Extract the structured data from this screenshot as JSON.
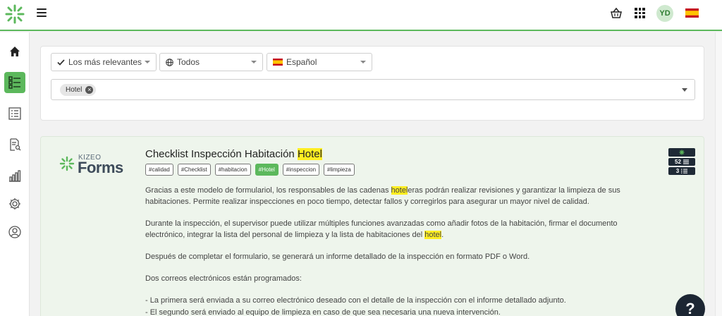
{
  "header": {
    "avatar_initials": "YD",
    "accent_color": "#5cb85c",
    "icons": [
      "kizeo-logo-icon",
      "hamburger-menu-icon",
      "basket-icon",
      "apps-grid-icon",
      "spain-flag-icon"
    ]
  },
  "sidebar": {
    "items": [
      {
        "name": "home",
        "icon": "home-icon",
        "active": false
      },
      {
        "name": "checklist",
        "icon": "checklist-icon",
        "active": true
      },
      {
        "name": "list",
        "icon": "list-icon",
        "active": false
      },
      {
        "name": "document-search",
        "icon": "document-search-icon",
        "active": false
      },
      {
        "name": "statistics",
        "icon": "bar-chart-icon",
        "active": false
      },
      {
        "name": "settings",
        "icon": "gear-icon",
        "active": false
      },
      {
        "name": "user",
        "icon": "user-icon",
        "active": false
      }
    ]
  },
  "filters": {
    "sort": "Los más relevantes",
    "scope": "Todos",
    "language": "Español",
    "selected_tags": [
      "Hotel"
    ]
  },
  "result": {
    "brand_small": "KIZEO",
    "brand_large": "Forms",
    "title_prefix": "Checklist Inspección Habitación ",
    "title_highlight": "Hotel",
    "tags": [
      "#calidad",
      "#Checklist",
      "#habitacion",
      "#Hotel",
      "#inspeccion",
      "#limpieza"
    ],
    "active_tag": "#Hotel",
    "badges": {
      "pages": "52",
      "lists": "3"
    },
    "description": {
      "p1_before": "Gracias a este modelo de formulariol, los responsables de las cadenas ",
      "p1_highlight": "hotel",
      "p1_after": "eras podrán realizar revisiones y garantizar la limpieza de sus habitaciones. Permite realizar inspecciones en poco tiempo, detectar fallos y corregirlos para asegurar un mayor nivel de calidad.",
      "p2_before": "Durante la inspección, el supervisor puede utilizar múltiples funciones avanzadas como añadir fotos de la habitación, firmar el documento electrónico, integrar la lista del personal de limpieza y la lista de habitaciones del ",
      "p2_highlight": "hotel",
      "p2_after": ".",
      "p3": "Después de completar el formulario, se generará un informe detallado de la inspección en formato PDF o Word.",
      "p4": "Dos correos electrónicos están programados:",
      "b1": "- La primera será enviada a su correo electrónico deseado con el detalle de la inspección con el informe detallado adjunto.",
      "b2": "- El segundo será enviado al equipo de limpieza en caso de que sea necesaria una nueva intervención."
    }
  },
  "help": {
    "label": "?"
  }
}
